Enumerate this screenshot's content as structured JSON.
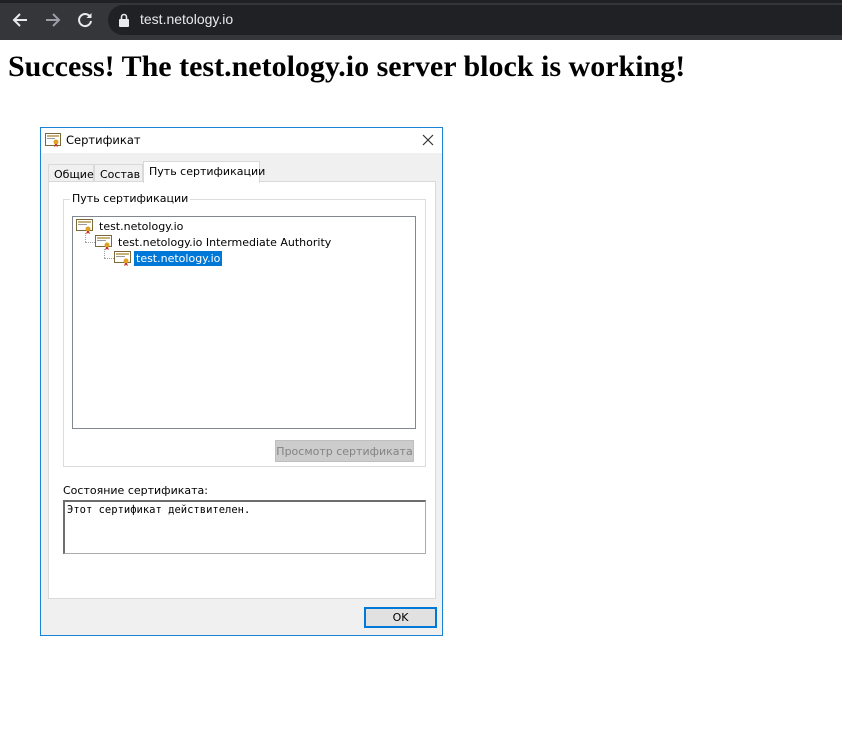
{
  "browser": {
    "url": "test.netology.io",
    "icons": {
      "back": "arrow-left-icon",
      "forward": "arrow-right-icon",
      "reload": "reload-icon",
      "lock": "lock-icon"
    }
  },
  "page": {
    "heading": "Success! The test.netology.io server block is working!"
  },
  "dialog": {
    "title": "Сертификат",
    "tabs": [
      "Общие",
      "Состав",
      "Путь сертификации"
    ],
    "active_tab": "Путь сертификации",
    "group_label": "Путь сертификации",
    "tree": [
      {
        "label": "test.netology.io",
        "level": 0,
        "selected": false
      },
      {
        "label": "test.netology.io Intermediate Authority",
        "level": 1,
        "selected": false
      },
      {
        "label": "test.netology.io",
        "level": 2,
        "selected": true
      }
    ],
    "view_button": "Просмотр сертификата",
    "status_label": "Состояние сертификата:",
    "status_text": "Этот сертификат действителен.",
    "ok_button": "OK",
    "colors": {
      "accent": "#0078d7",
      "border": "#1883d7"
    }
  }
}
